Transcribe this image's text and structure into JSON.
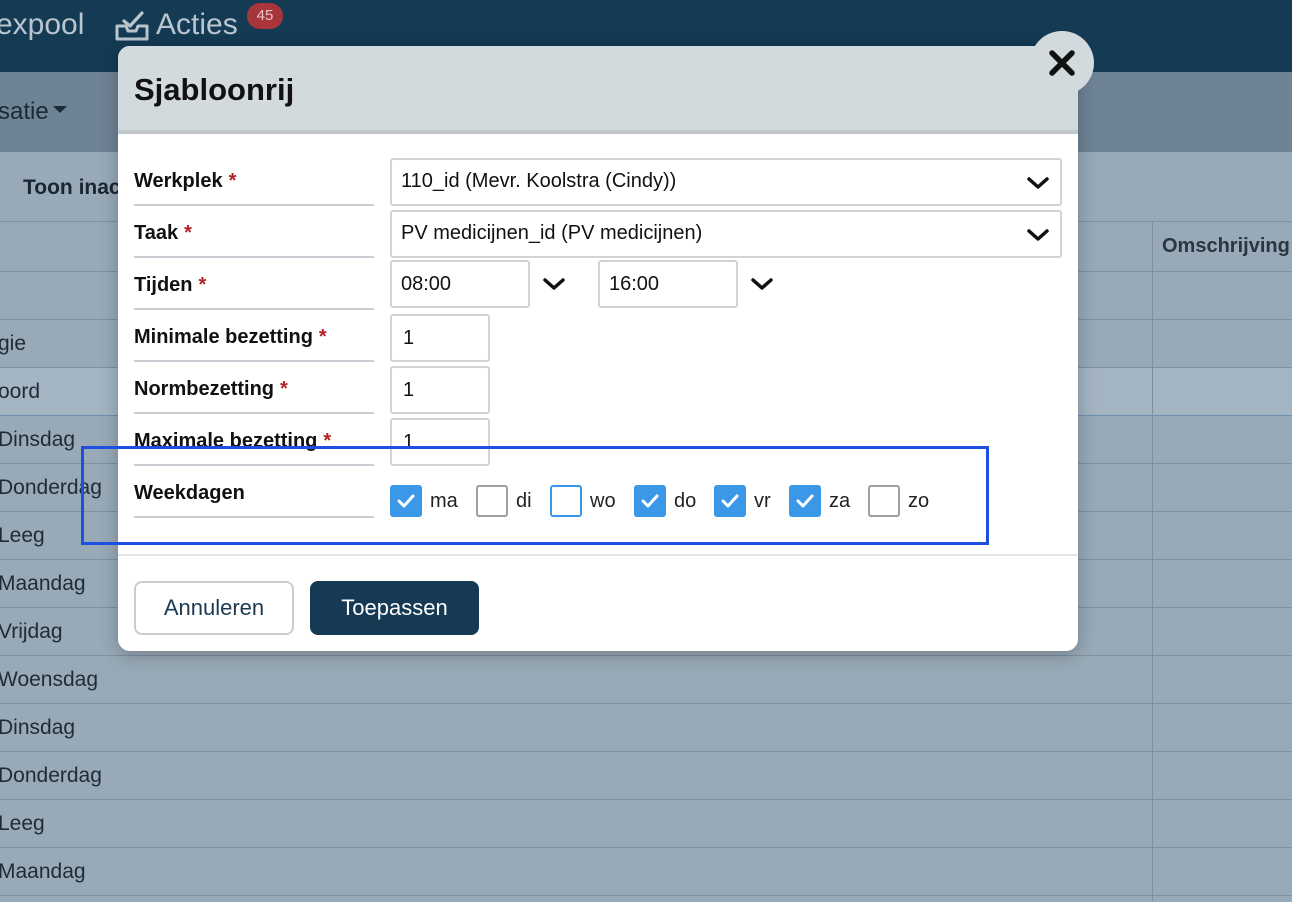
{
  "app": {
    "nav_pool": "expool",
    "nav_acties": "Acties",
    "acties_badge": "45",
    "org_menu": "satie",
    "toon_filter": "Toon inac",
    "column_omschrijving": "Omschrijving",
    "rows": [
      "",
      "gie",
      "oord",
      "Dinsdag",
      "Donderdag",
      "Leeg",
      "Maandag",
      "Vrijdag",
      "Woensdag",
      "Dinsdag",
      "Donderdag",
      "Leeg",
      "Maandag"
    ]
  },
  "modal": {
    "title": "Sjabloonrij",
    "required_mark": "*",
    "fields": {
      "werkplek": {
        "label": "Werkplek",
        "value": "110_id (Mevr. Koolstra (Cindy))"
      },
      "taak": {
        "label": "Taak",
        "value": "PV medicijnen_id (PV medicijnen)"
      },
      "tijden": {
        "label": "Tijden",
        "start": "08:00",
        "end": "16:00"
      },
      "min_bezetting": {
        "label": "Minimale bezetting",
        "value": "1"
      },
      "norm_bezetting": {
        "label": "Normbezetting",
        "value": "1"
      },
      "max_bezetting": {
        "label": "Maximale bezetting",
        "value": "1"
      },
      "weekdagen": {
        "label": "Weekdagen"
      }
    },
    "weekdays": [
      {
        "label": "ma",
        "checked": true
      },
      {
        "label": "di",
        "checked": false
      },
      {
        "label": "wo",
        "checked": false,
        "focused": true
      },
      {
        "label": "do",
        "checked": true
      },
      {
        "label": "vr",
        "checked": true
      },
      {
        "label": "za",
        "checked": true
      },
      {
        "label": "zo",
        "checked": false
      }
    ],
    "buttons": {
      "cancel": "Annuleren",
      "apply": "Toepassen"
    }
  },
  "colors": {
    "topbar": "#143a54",
    "primary_button": "#163a54",
    "checkbox_checked": "#3b98e8",
    "required": "#b21f24",
    "highlight": "#1f4fe0",
    "badge": "#a8343c"
  },
  "icons": {
    "close": "close-icon",
    "dropdown": "chevron-down-icon",
    "checkbox_check": "check-icon",
    "acties": "inbox-icon"
  }
}
